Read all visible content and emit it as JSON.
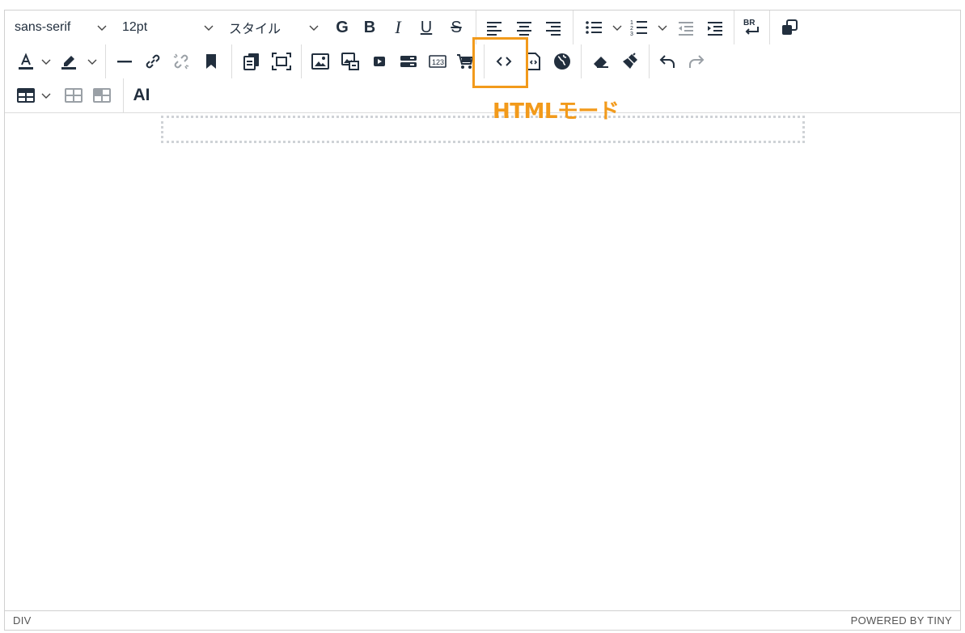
{
  "toolbar": {
    "font_family": "sans-serif",
    "font_size": "12pt",
    "style": "スタイル",
    "bold_g": "G",
    "bold_b": "B",
    "italic": "I",
    "underline": "U",
    "strike": "S",
    "br_label": "BR",
    "ai_label": "AI",
    "num_label": "123"
  },
  "annotation": {
    "callout": "HTMLモード",
    "color": "#f29a1b"
  },
  "statusbar": {
    "path": "DIV",
    "branding": "POWERED BY TINY"
  }
}
